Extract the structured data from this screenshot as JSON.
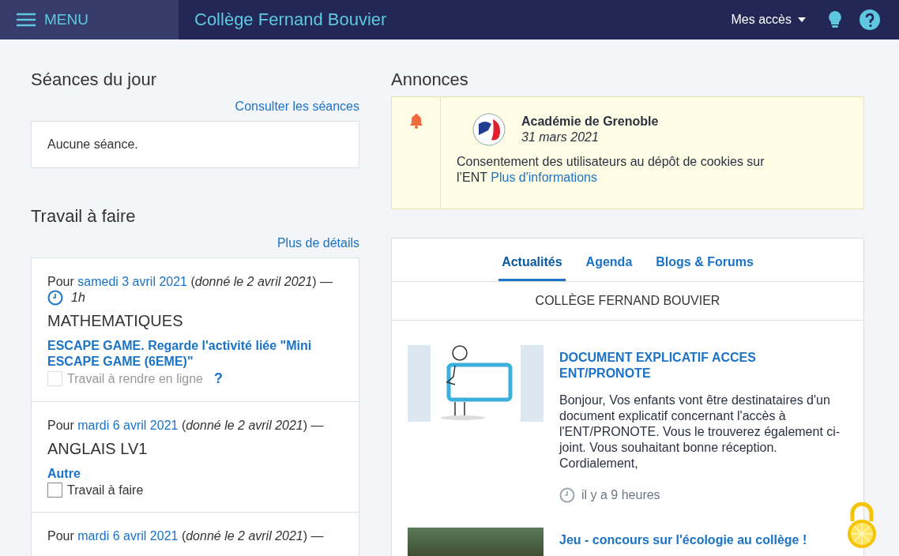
{
  "header": {
    "menu_label": "MENU",
    "school": "Collège Fernand Bouvier",
    "access": "Mes accès"
  },
  "sessions": {
    "title": "Séances du jour",
    "link": "Consulter les séances",
    "empty": "Aucune séance."
  },
  "homework": {
    "title": "Travail à faire",
    "link": "Plus de détails",
    "items": [
      {
        "prefix": "Pour",
        "date": "samedi 3 avril 2021",
        "given": "(*donné le 2 avril 2021*) —",
        "duration": "1h",
        "subject": "MATHEMATIQUES",
        "task": "ESCAPE GAME. Regarde l'activité liée \"Mini ESCAPE GAME (6EME)\"",
        "checkbox": {
          "label": "Travail à rendre en ligne",
          "checked": false,
          "disabled": true
        },
        "help": "?"
      },
      {
        "prefix": "Pour",
        "date": "mardi 6 avril 2021",
        "given": "(*donné le 2 avril 2021*) —",
        "subject": "ANGLAIS LV1",
        "task": "Autre",
        "checkbox": {
          "label": "Travail à faire",
          "checked": false,
          "disabled": false
        }
      },
      {
        "prefix": "Pour",
        "date": "mardi 6 avril 2021",
        "given": "(*donné le 2 avril 2021*) —"
      }
    ]
  },
  "announcements": {
    "title": "Annonces",
    "author": "Académie de Grenoble",
    "date": "31 mars 2021",
    "text": "Consentement des utilisateurs au dépôt de cookies sur l’ENT",
    "link": "Plus d'informations"
  },
  "news": {
    "tabs": [
      {
        "label": "Actualités",
        "selected": true
      },
      {
        "label": "Agenda",
        "selected": false
      },
      {
        "label": "Blogs & Forums",
        "selected": false
      }
    ],
    "school": "COLLÈGE FERNAND BOUVIER",
    "items": [
      {
        "kind": "illustration",
        "title": "DOCUMENT EXPLICATIF ACCES ENT/PRONOTE",
        "body": "Bonjour, Vos enfants vont être destinataires d'un document explicatif concernant l'accès à l'ENT/PRONOTE. Vous le trouverez également ci-joint. Vous souhaitant bonne réception. Cordialement,",
        "time": "il y a 9 heures"
      },
      {
        "kind": "photo",
        "title": "Jeu - concours sur l'écologie au collège !"
      }
    ]
  }
}
